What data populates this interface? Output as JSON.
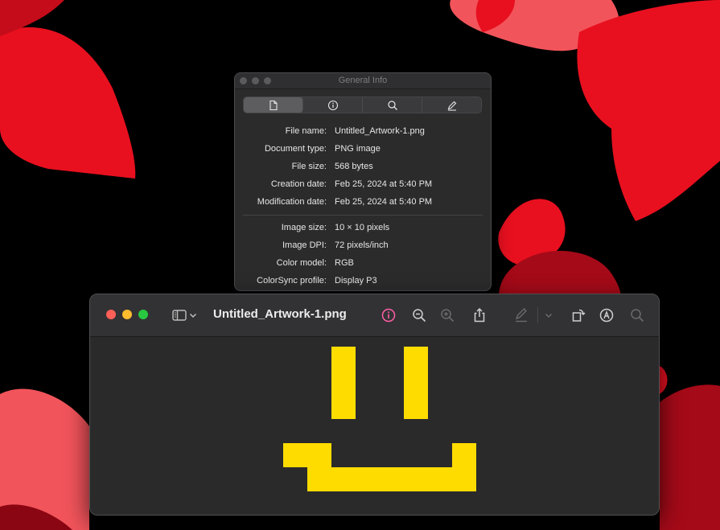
{
  "colors": {
    "desktop_bg": "#000000",
    "wallpaper_red": "#e8101f",
    "wallpaper_pink": "#f2545b",
    "wallpaper_dark_red": "#a50a18",
    "artwork_yellow": "#ffdc00",
    "info_accent_pink": "#ff5ea6"
  },
  "info_window": {
    "title": "General Info",
    "tabs": [
      {
        "icon": "document-icon",
        "active": true
      },
      {
        "icon": "info-circle-icon",
        "active": false
      },
      {
        "icon": "magnifier-icon",
        "active": false
      },
      {
        "icon": "pencil-icon",
        "active": false
      }
    ],
    "general": [
      {
        "label": "File name:",
        "value": "Untitled_Artwork-1.png"
      },
      {
        "label": "Document type:",
        "value": "PNG image"
      },
      {
        "label": "File size:",
        "value": "568 bytes"
      },
      {
        "label": "Creation date:",
        "value": "Feb 25, 2024 at 5:40 PM"
      },
      {
        "label": "Modification date:",
        "value": "Feb 25, 2024 at 5:40 PM"
      }
    ],
    "image": [
      {
        "label": "Image size:",
        "value": "10 × 10 pixels"
      },
      {
        "label": "Image DPI:",
        "value": "72 pixels/inch"
      },
      {
        "label": "Color model:",
        "value": "RGB"
      },
      {
        "label": "ColorSync profile:",
        "value": "Display P3"
      }
    ]
  },
  "preview_window": {
    "title": "Untitled_Artwork-1.png",
    "toolbar_icons": [
      "sidebar-icon",
      "chevron-down-icon",
      "info-icon",
      "zoom-out-icon",
      "zoom-in-icon",
      "share-icon",
      "markup-pen-icon",
      "chevron-down-icon",
      "rotate-icon",
      "annotate-icon",
      "search-icon"
    ],
    "artwork": {
      "description_grid_size": "10x10",
      "pixels": [
        [
          2,
          0
        ],
        [
          2,
          1
        ],
        [
          2,
          2
        ],
        [
          5,
          0
        ],
        [
          5,
          1
        ],
        [
          5,
          2
        ],
        [
          0,
          4
        ],
        [
          1,
          4
        ],
        [
          7,
          4
        ],
        [
          8,
          4
        ],
        [
          1,
          5
        ],
        [
          2,
          5
        ],
        [
          3,
          5
        ],
        [
          4,
          5
        ],
        [
          5,
          5
        ],
        [
          6,
          5
        ],
        [
          7,
          5
        ]
      ]
    }
  }
}
